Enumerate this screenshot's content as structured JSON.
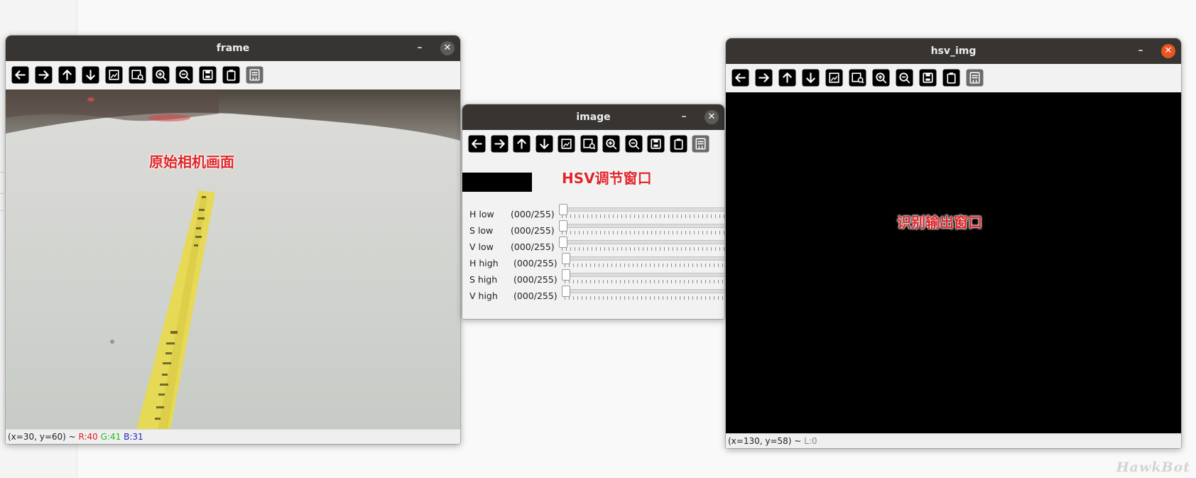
{
  "windows": {
    "frame": {
      "title": "frame",
      "annotation": "原始相机画面",
      "status": {
        "coords": "(x=30, y=60) ~ ",
        "r": "R:40",
        "g": "G:41",
        "b": "B:31"
      }
    },
    "image": {
      "title": "image",
      "annotation": "HSV调节窗口",
      "trackbars": [
        {
          "name": "H low",
          "value": "(000/255)",
          "level": 0
        },
        {
          "name": "S low",
          "value": "(000/255)",
          "level": 0
        },
        {
          "name": "V low",
          "value": "(000/255)",
          "level": 0
        },
        {
          "name": "H high",
          "value": "(000/255)",
          "level": 0
        },
        {
          "name": "S high",
          "value": "(000/255)",
          "level": 0
        },
        {
          "name": "V high",
          "value": "(000/255)",
          "level": 0
        }
      ]
    },
    "hsv_img": {
      "title": "hsv_img",
      "annotation": "识别输出窗口",
      "status": {
        "coords": "(x=130, y=58) ~ ",
        "l": "L:0"
      }
    }
  },
  "window_controls": {
    "minimize": "–",
    "close": "✕"
  },
  "toolbar_icons": [
    "pan-left-icon",
    "pan-right-icon",
    "pan-up-icon",
    "pan-down-icon",
    "zoom-fit-icon",
    "zoom-original-icon",
    "zoom-in-icon",
    "zoom-out-icon",
    "save-icon",
    "copy-clipboard-icon",
    "properties-icon"
  ],
  "colors": {
    "titlebar": "#373432",
    "close_active": "#e95420",
    "annotation": "#e0262a",
    "status_r": "#e02020",
    "status_g": "#23b823",
    "status_b": "#2020c8"
  },
  "watermark": "HawkBot"
}
